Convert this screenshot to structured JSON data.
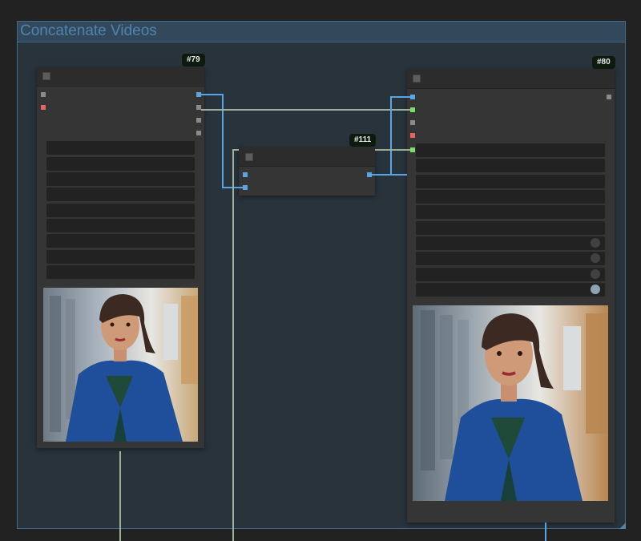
{
  "group": {
    "title": "Concatenate Videos",
    "color": "#3f6a88"
  },
  "nodes": [
    {
      "id": "#79",
      "kind": "video-loader",
      "inputs": 2,
      "outputs": 4,
      "widgets": 9
    },
    {
      "id": "#111",
      "kind": "image-concat",
      "inputs": 2,
      "outputs": 1
    },
    {
      "id": "#80",
      "kind": "video-combine",
      "inputs": 5,
      "outputs": 1,
      "widgets": 10,
      "toggles": 4
    }
  ],
  "preview": {
    "subject": "woman in blue blazer in a hallway"
  },
  "colors": {
    "image_wire": "#59a4e5",
    "latent_wire": "#9ab09a",
    "canvas": "#222222",
    "group_fill": "#29333c"
  }
}
